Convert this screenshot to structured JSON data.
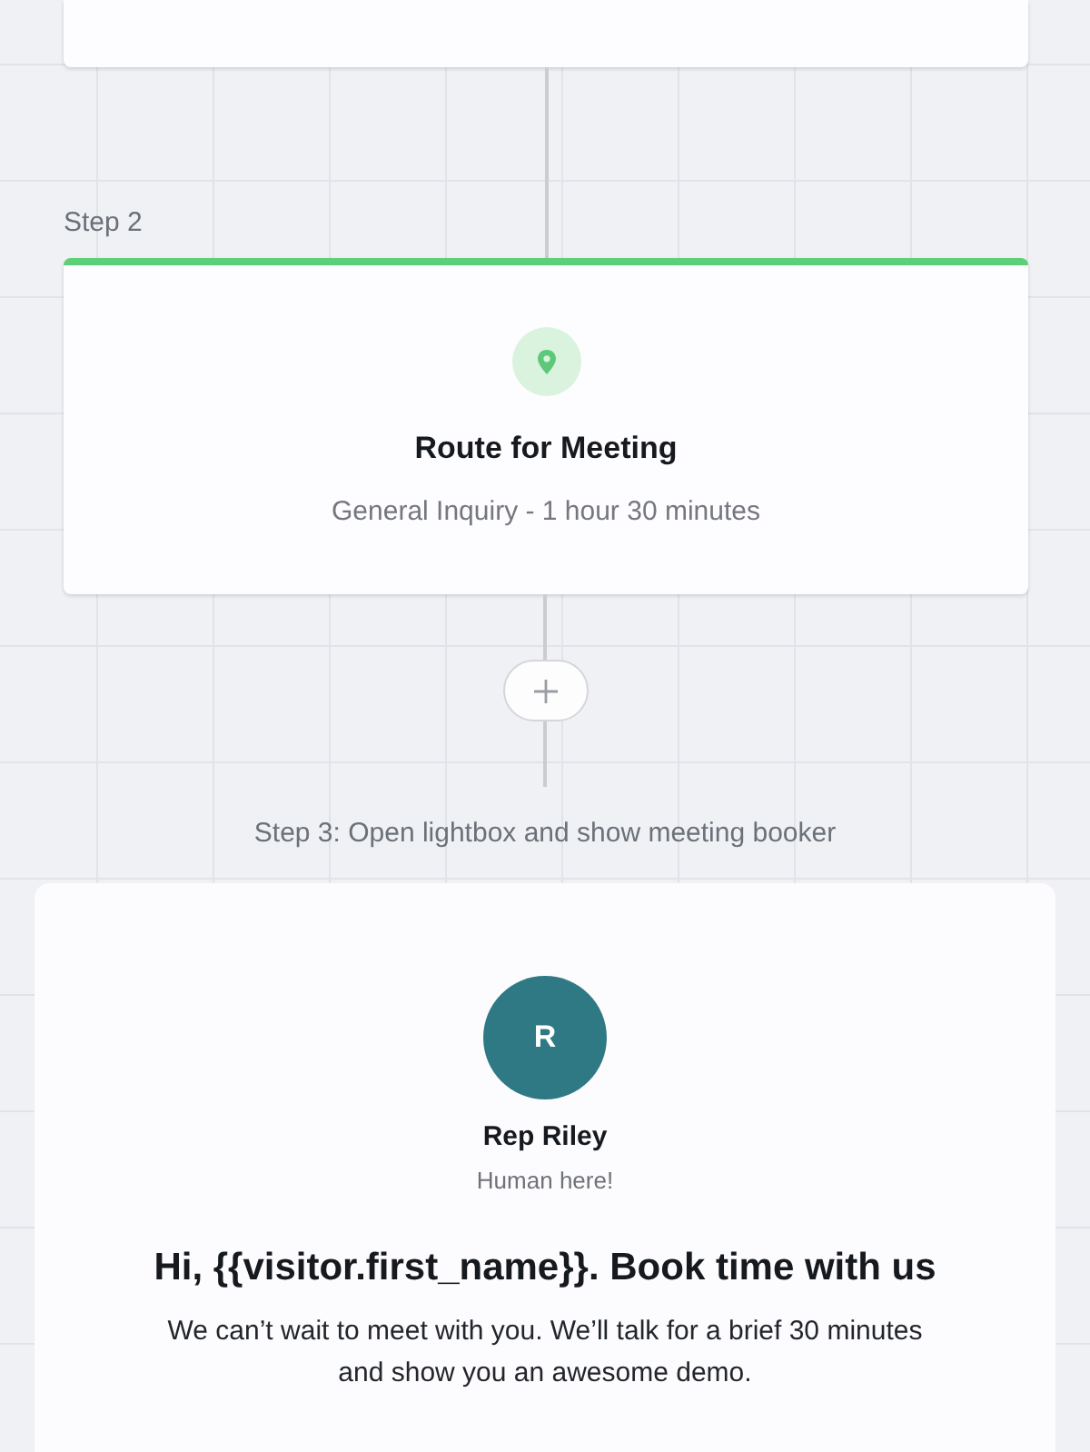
{
  "route_step": {
    "kind": "route",
    "label": "Step 2",
    "title": "Route for Meeting",
    "subtitle": "General Inquiry - 1 hour 30 minutes"
  },
  "booker_step": {
    "label": "Step 3: Open lightbox and show meeting booker",
    "avatar_initial": "R",
    "rep_name": "Rep Riley",
    "rep_tagline": "Human here!",
    "heading": "Hi, {{visitor.first_name}}. Book time with us",
    "message": "We can’t wait to meet with you. We’ll talk for a brief 30 minutes and show you an awesome demo."
  }
}
